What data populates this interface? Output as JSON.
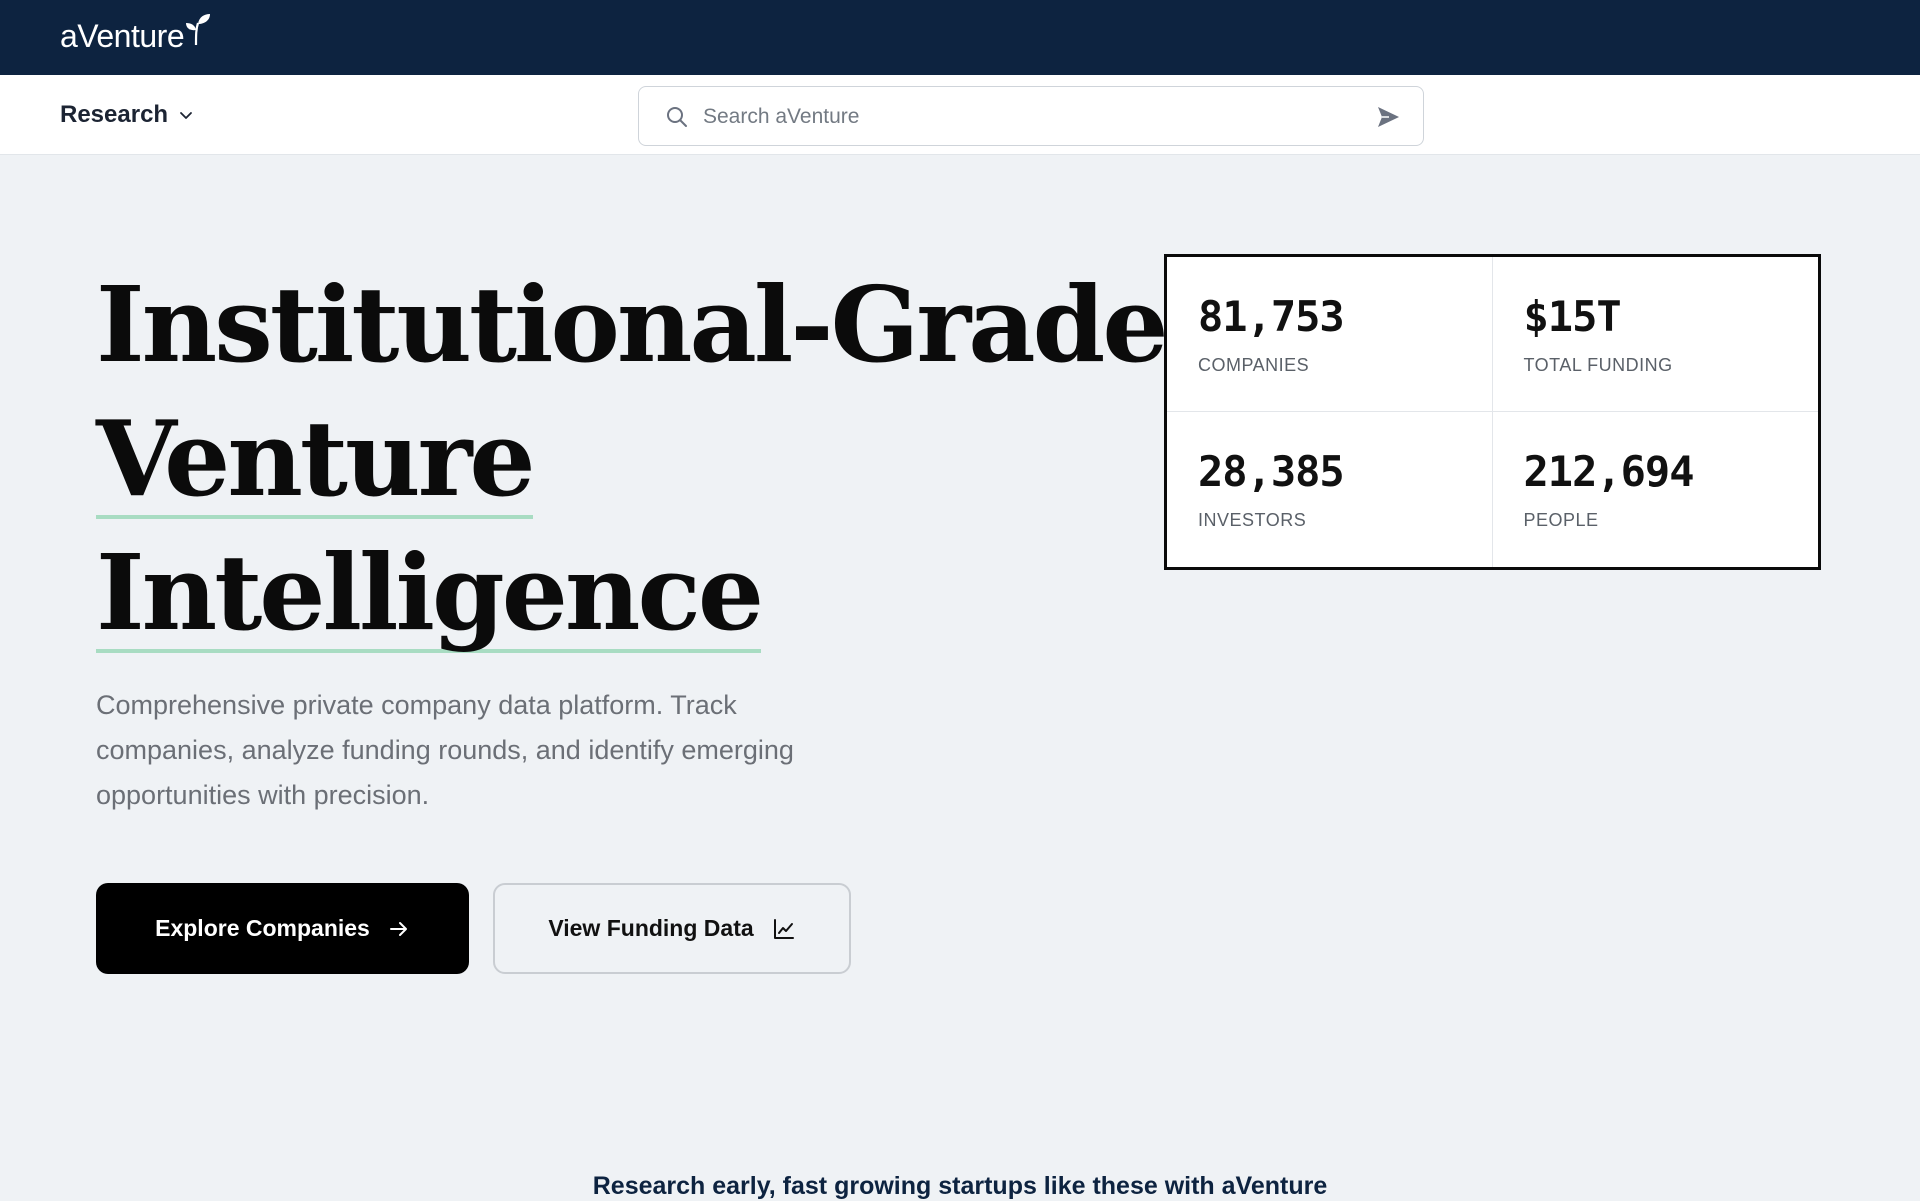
{
  "brand": {
    "name": "aVenture"
  },
  "nav": {
    "research_label": "Research"
  },
  "search": {
    "placeholder": "Search aVenture"
  },
  "hero": {
    "title_line1": "Institutional-Grade",
    "title_line2": "Venture",
    "title_line3": "Intelligence",
    "description": "Comprehensive private company data platform. Track companies, analyze funding rounds, and identify emerging opportunities with precision.",
    "primary_button": "Explore Companies",
    "secondary_button": "View Funding Data"
  },
  "stats": [
    {
      "value": "81,753",
      "label": "COMPANIES"
    },
    {
      "value": "$15T",
      "label": "TOTAL FUNDING"
    },
    {
      "value": "28,385",
      "label": "INVESTORS"
    },
    {
      "value": "212,694",
      "label": "PEOPLE"
    }
  ],
  "tagline": "Research early, fast growing startups like these with aVenture",
  "colors": {
    "header_bg": "#0d2340",
    "page_bg": "#eff2f5",
    "accent_underline": "#a8dcc2",
    "primary_button_bg": "#000000"
  },
  "icons": [
    "sprout-icon",
    "chevron-down-icon",
    "search-icon",
    "send-icon",
    "arrow-right-icon",
    "line-chart-icon"
  ]
}
